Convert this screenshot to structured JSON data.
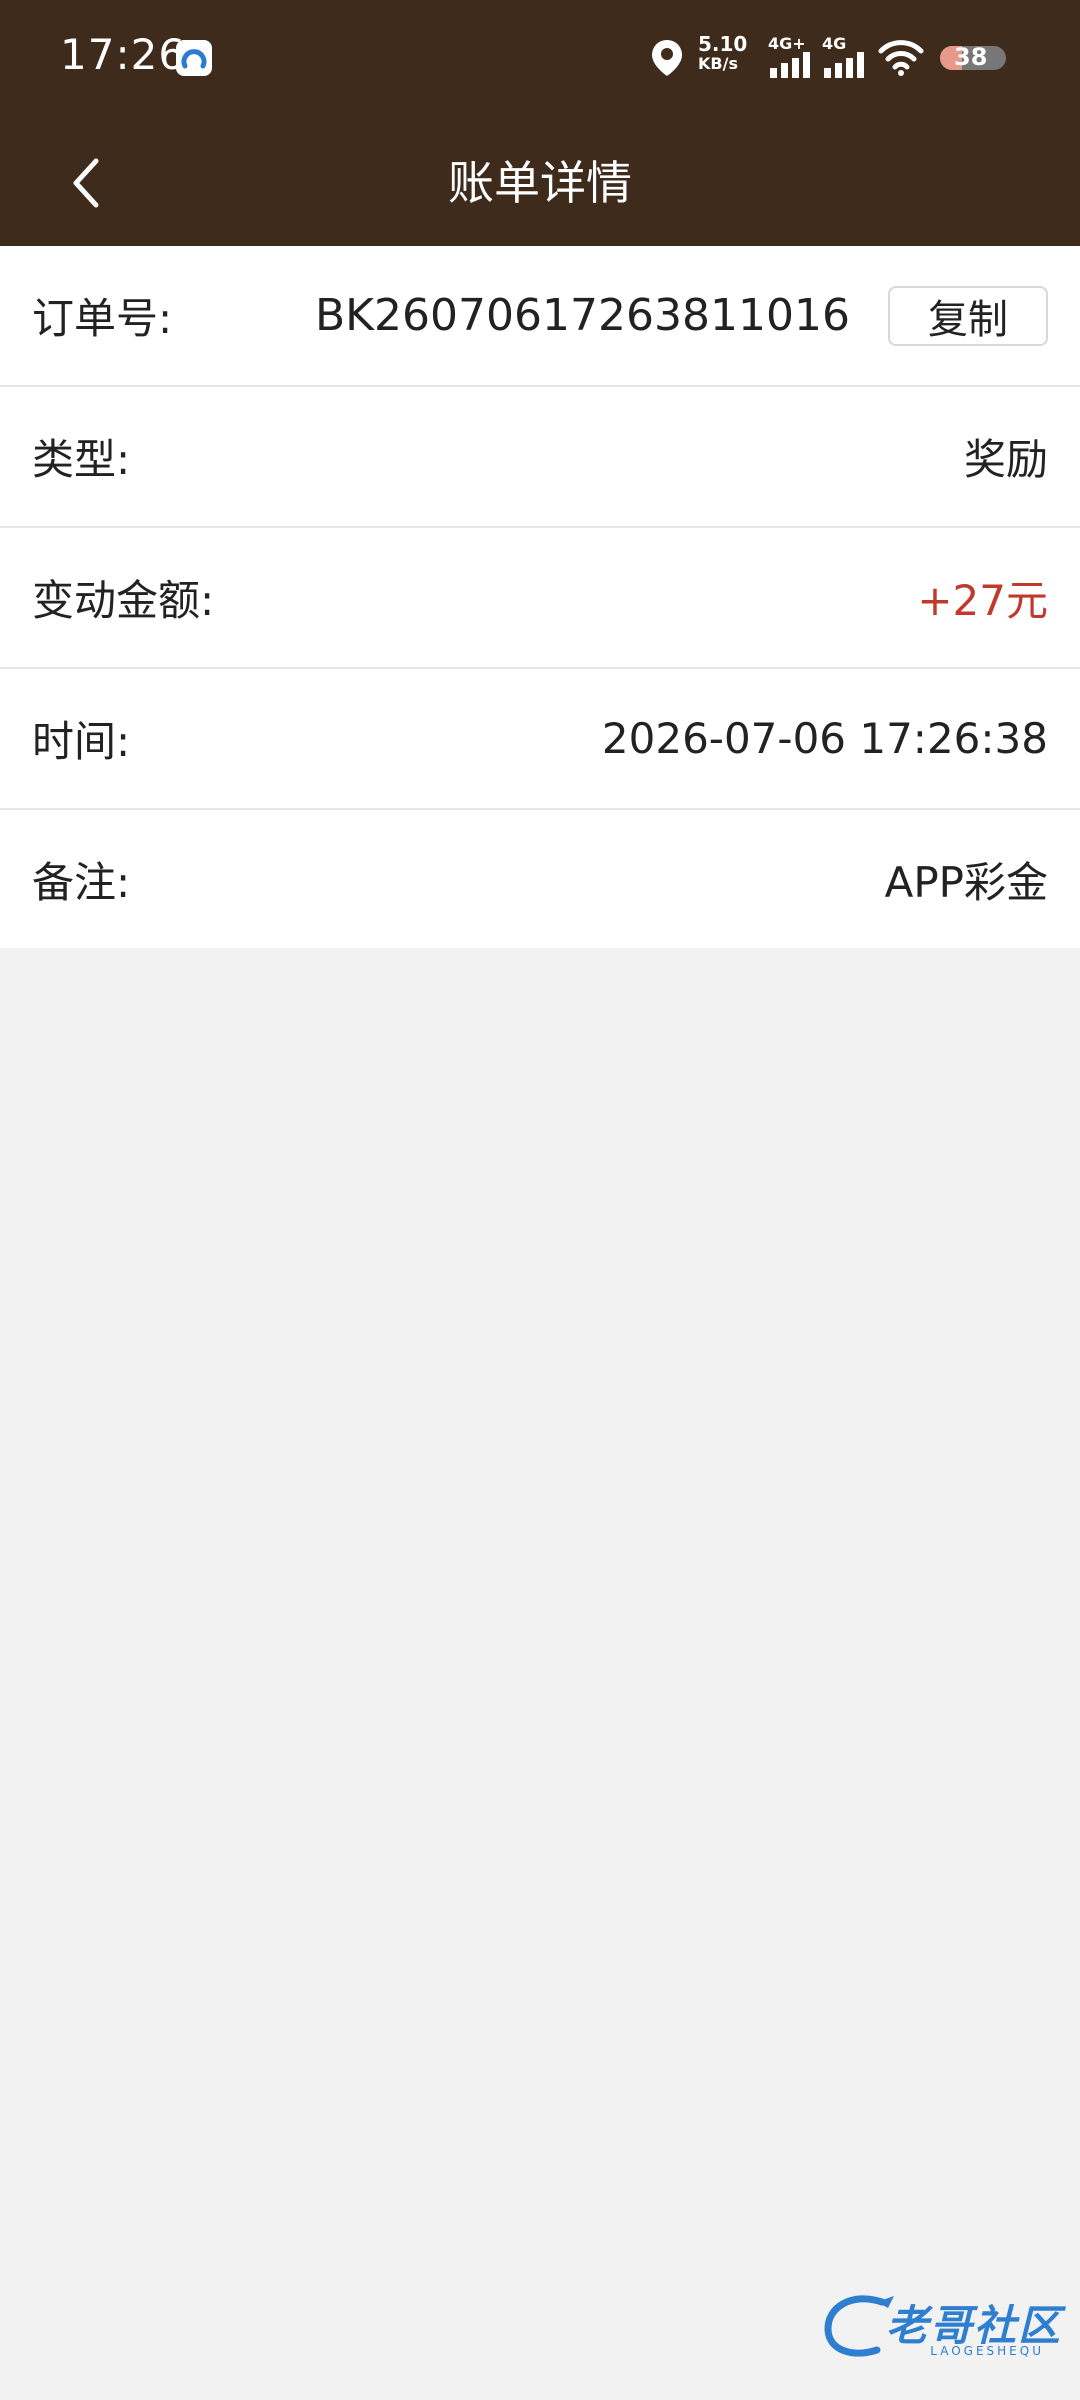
{
  "status_bar": {
    "time": "17:26",
    "net_speed_value": "5.10",
    "net_speed_unit": "KB/s",
    "signal1": "4G+",
    "signal2": "4G",
    "battery": "38"
  },
  "nav": {
    "title": "账单详情"
  },
  "details": {
    "order_label": "订单号:",
    "order_value": "BK26070617263811016",
    "copy_label": "复制",
    "type_label": "类型:",
    "type_value": "奖励",
    "amount_label": "变动金额:",
    "amount_value": "+27元",
    "time_label": "时间:",
    "time_value": "2026-07-06 17:26:38",
    "note_label": "备注:",
    "note_value": "APP彩金"
  },
  "colors": {
    "header_bg": "#3f2b1c",
    "amount_red": "#c0392b",
    "page_bg": "#f2f2f2"
  },
  "watermark": {
    "text": "老哥社区",
    "sub": "LAOGESHEQU"
  }
}
